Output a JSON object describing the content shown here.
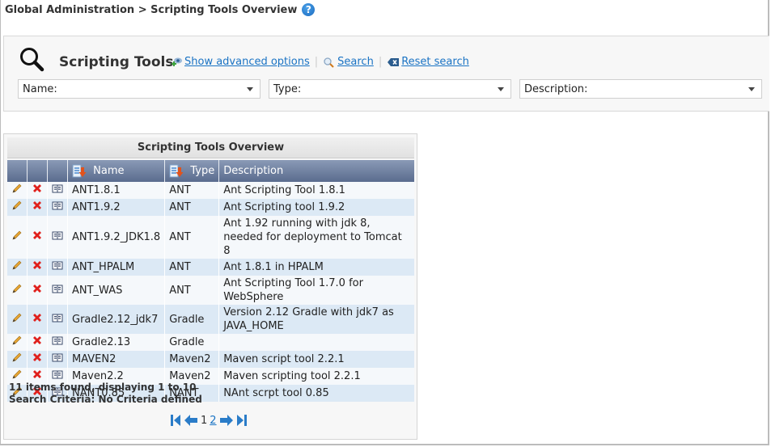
{
  "breadcrumb": {
    "text": "Global Administration > Scripting Tools Overview",
    "help_icon": "help-icon",
    "help_glyph": "?"
  },
  "search_panel": {
    "icon": "magnifier-icon",
    "title": "Scripting Tools",
    "links": {
      "advanced": "Show advanced options",
      "search": "Search",
      "reset": "Reset search",
      "separator": "|"
    },
    "filters": {
      "name": "Name:",
      "type": "Type:",
      "description": "Description:"
    }
  },
  "grid": {
    "caption": "Scripting Tools Overview",
    "columns": [
      "",
      "",
      "",
      "Name",
      "Type",
      "Description"
    ],
    "rows": [
      {
        "name": "ANT1.8.1",
        "type": "ANT",
        "description": "Ant Scripting Tool 1.8.1"
      },
      {
        "name": "ANT1.9.2",
        "type": "ANT",
        "description": "Ant Scripting tool 1.9.2"
      },
      {
        "name": "ANT1.9.2_JDK1.8",
        "type": "ANT",
        "description": "Ant 1.92 running with jdk 8, needed for deployment to Tomcat 8"
      },
      {
        "name": "ANT_HPALM",
        "type": "ANT",
        "description": "Ant 1.8.1 in HPALM"
      },
      {
        "name": "ANT_WAS",
        "type": "ANT",
        "description": "Ant Scripting Tool 1.7.0 for WebSphere"
      },
      {
        "name": "Gradle2.12_jdk7",
        "type": "Gradle",
        "description": "Version 2.12 Gradle with jdk7 as JAVA_HOME"
      },
      {
        "name": "Gradle2.13",
        "type": "Gradle",
        "description": ""
      },
      {
        "name": "MAVEN2",
        "type": "Maven2",
        "description": "Maven script tool 2.2.1"
      },
      {
        "name": "Maven2.2",
        "type": "Maven2",
        "description": "Maven scripting tool 2.2.1"
      },
      {
        "name": "NANT0.85",
        "type": "NANT",
        "description": "NAnt scrpt tool 0.85"
      }
    ],
    "footer": {
      "count": "11 items found, displaying 1 to 10",
      "criteria": "Search Criteria: No Criteria defined"
    },
    "pager": {
      "current_page": "1",
      "next_page": "2"
    }
  },
  "colors": {
    "link": "#1a73c4",
    "header_top": "#8a9ab6",
    "header_bottom": "#5a6c8e",
    "row_alt": "#dce9f5",
    "row": "#f5f8fb"
  }
}
